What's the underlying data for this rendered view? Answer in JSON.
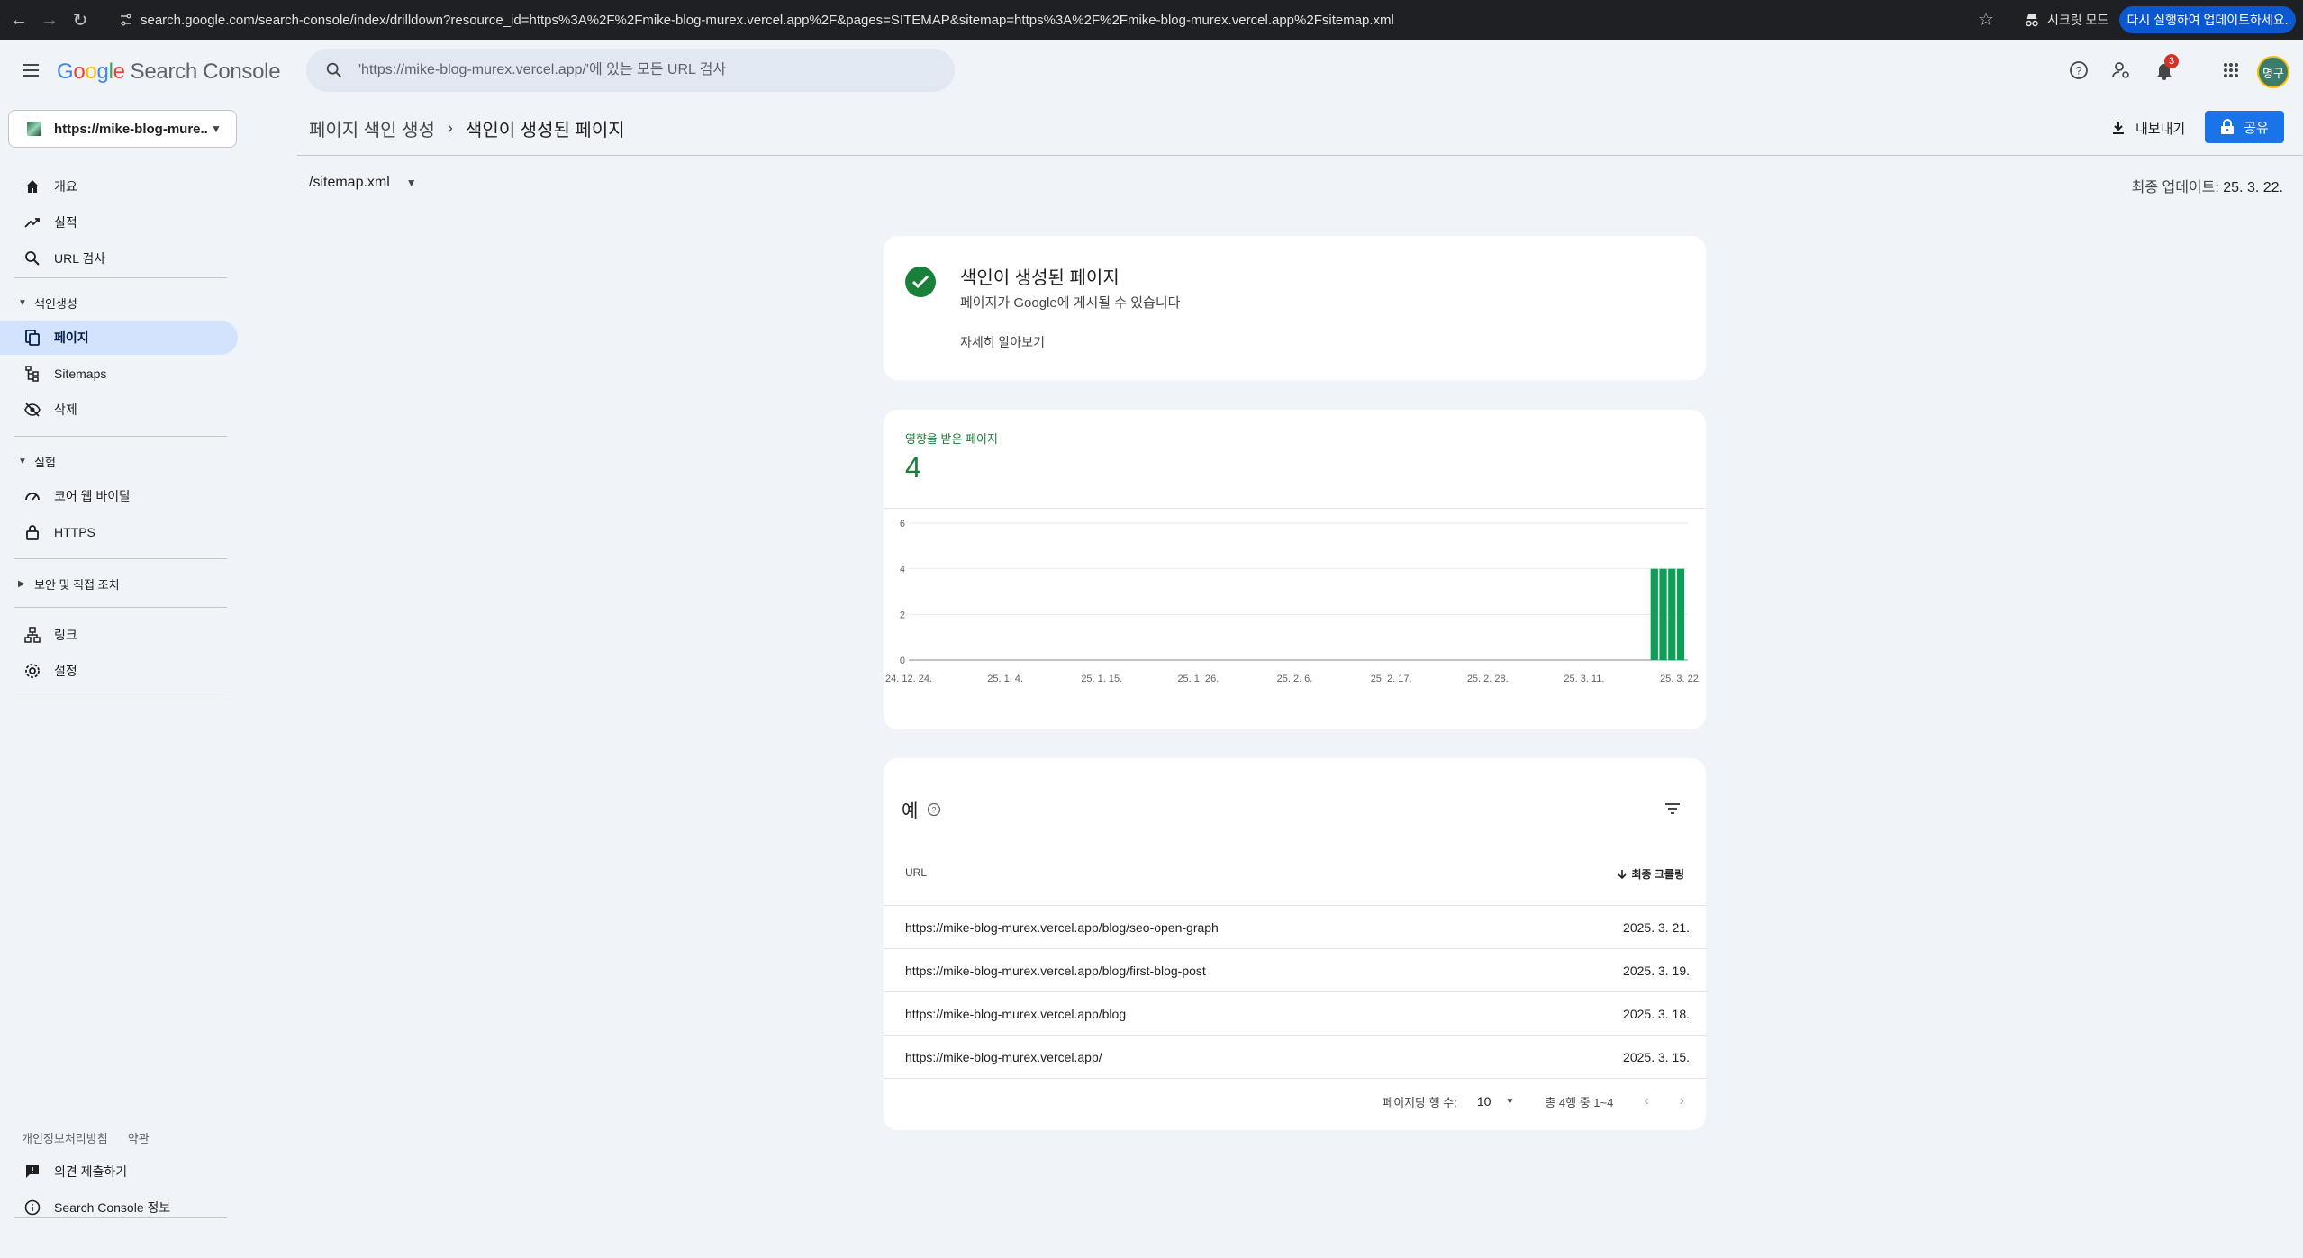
{
  "browser": {
    "url": "search.google.com/search-console/index/drilldown?resource_id=https%3A%2F%2Fmike-blog-murex.vercel.app%2F&pages=SITEMAP&sitemap=https%3A%2F%2Fmike-blog-murex.vercel.app%2Fsitemap.xml",
    "incognito_label": "시크릿 모드",
    "update_label": "다시 실행하여 업데이트하세요."
  },
  "header": {
    "logo_google": [
      "G",
      "o",
      "o",
      "g",
      "l",
      "e"
    ],
    "logo_product": "Search Console",
    "search_placeholder": "'https://mike-blog-murex.vercel.app/'에 있는 모든 URL 검사",
    "notification_count": "3",
    "avatar_text": "명구"
  },
  "sidebar": {
    "property": "https://mike-blog-mure...",
    "items_top": [
      {
        "label": "개요",
        "icon": "home-icon"
      },
      {
        "label": "실적",
        "icon": "trending-up-icon"
      },
      {
        "label": "URL 검사",
        "icon": "search-icon"
      }
    ],
    "section_indexing": "색인생성",
    "items_indexing": [
      {
        "label": "페이지",
        "icon": "pages-icon",
        "active": true
      },
      {
        "label": "Sitemaps",
        "icon": "sitemap-icon"
      },
      {
        "label": "삭제",
        "icon": "visibility-off-icon"
      }
    ],
    "section_experience": "실험",
    "items_experience": [
      {
        "label": "코어 웹 바이탈",
        "icon": "speed-icon"
      },
      {
        "label": "HTTPS",
        "icon": "lock-icon"
      }
    ],
    "section_security": "보안 및 직접 조치",
    "items_bottom": [
      {
        "label": "링크",
        "icon": "links-icon"
      },
      {
        "label": "설정",
        "icon": "gear-icon"
      }
    ],
    "feedback": "의견 제출하기",
    "about": "Search Console 정보",
    "privacy": "개인정보처리방침",
    "terms": "약관"
  },
  "main": {
    "breadcrumb_parent": "페이지 색인 생성",
    "breadcrumb_current": "색인이 생성된 페이지",
    "export_label": "내보내기",
    "share_label": "공유",
    "sitemap_value": "/sitemap.xml",
    "last_updated_label": "최종 업데이트:",
    "last_updated_value": "25. 3. 22.",
    "status_title": "색인이 생성된 페이지",
    "status_subtitle": "페이지가 Google에 게시될 수 있습니다",
    "status_link": "자세히 알아보기",
    "metric_label": "영향을 받은 페이지",
    "metric_value": "4",
    "table_title": "예",
    "col_url": "URL",
    "col_crawl": "최종 크롤링",
    "rows": [
      {
        "url": "https://mike-blog-murex.vercel.app/blog/seo-open-graph",
        "date": "2025. 3. 21."
      },
      {
        "url": "https://mike-blog-murex.vercel.app/blog/first-blog-post",
        "date": "2025. 3. 19."
      },
      {
        "url": "https://mike-blog-murex.vercel.app/blog",
        "date": "2025. 3. 18."
      },
      {
        "url": "https://mike-blog-murex.vercel.app/",
        "date": "2025. 3. 15."
      }
    ],
    "rows_per_page_label": "페이지당 행 수:",
    "rows_per_page_value": "10",
    "range_label": "총 4행 중 1~4"
  },
  "colors": {
    "accent": "#1a73e8",
    "success": "#188038",
    "bar": "#0f9d58",
    "active_nav": "#d3e3fd"
  },
  "chart_data": {
    "type": "bar",
    "title": "",
    "ylabel": "",
    "xlabel": "",
    "ylim": [
      0,
      6
    ],
    "yticks": [
      0,
      2,
      4,
      6
    ],
    "xticks": [
      "24. 12. 24.",
      "25. 1. 4.",
      "25. 1. 15.",
      "25. 1. 26.",
      "25. 2. 6.",
      "25. 2. 17.",
      "25. 2. 28.",
      "25. 3. 11.",
      "25. 3. 22."
    ],
    "x": [
      "24. 12. 24.",
      "24. 12. 25.",
      "24. 12. 26.",
      "24. 12. 27.",
      "24. 12. 28.",
      "24. 12. 29.",
      "24. 12. 30.",
      "24. 12. 31.",
      "25. 1. 1.",
      "25. 1. 2.",
      "25. 1. 3.",
      "25. 1. 4.",
      "25. 1. 5.",
      "25. 1. 6.",
      "25. 1. 7.",
      "25. 1. 8.",
      "25. 1. 9.",
      "25. 1. 10.",
      "25. 1. 11.",
      "25. 1. 12.",
      "25. 1. 13.",
      "25. 1. 14.",
      "25. 1. 15.",
      "25. 1. 16.",
      "25. 1. 17.",
      "25. 1. 18.",
      "25. 1. 19.",
      "25. 1. 20.",
      "25. 1. 21.",
      "25. 1. 22.",
      "25. 1. 23.",
      "25. 1. 24.",
      "25. 1. 25.",
      "25. 1. 26.",
      "25. 1. 27.",
      "25. 1. 28.",
      "25. 1. 29.",
      "25. 1. 30.",
      "25. 1. 31.",
      "25. 2. 1.",
      "25. 2. 2.",
      "25. 2. 3.",
      "25. 2. 4.",
      "25. 2. 5.",
      "25. 2. 6.",
      "25. 2. 7.",
      "25. 2. 8.",
      "25. 2. 9.",
      "25. 2. 10.",
      "25. 2. 11.",
      "25. 2. 12.",
      "25. 2. 13.",
      "25. 2. 14.",
      "25. 2. 15.",
      "25. 2. 16.",
      "25. 2. 17.",
      "25. 2. 18.",
      "25. 2. 19.",
      "25. 2. 20.",
      "25. 2. 21.",
      "25. 2. 22.",
      "25. 2. 23.",
      "25. 2. 24.",
      "25. 2. 25.",
      "25. 2. 26.",
      "25. 2. 27.",
      "25. 2. 28.",
      "25. 3. 1.",
      "25. 3. 2.",
      "25. 3. 3.",
      "25. 3. 4.",
      "25. 3. 5.",
      "25. 3. 6.",
      "25. 3. 7.",
      "25. 3. 8.",
      "25. 3. 9.",
      "25. 3. 10.",
      "25. 3. 11.",
      "25. 3. 12.",
      "25. 3. 13.",
      "25. 3. 14.",
      "25. 3. 15.",
      "25. 3. 16.",
      "25. 3. 17.",
      "25. 3. 18.",
      "25. 3. 19.",
      "25. 3. 20.",
      "25. 3. 21.",
      "25. 3. 22."
    ],
    "values": [
      0,
      0,
      0,
      0,
      0,
      0,
      0,
      0,
      0,
      0,
      0,
      0,
      0,
      0,
      0,
      0,
      0,
      0,
      0,
      0,
      0,
      0,
      0,
      0,
      0,
      0,
      0,
      0,
      0,
      0,
      0,
      0,
      0,
      0,
      0,
      0,
      0,
      0,
      0,
      0,
      0,
      0,
      0,
      0,
      0,
      0,
      0,
      0,
      0,
      0,
      0,
      0,
      0,
      0,
      0,
      0,
      0,
      0,
      0,
      0,
      0,
      0,
      0,
      0,
      0,
      0,
      0,
      0,
      0,
      0,
      0,
      0,
      0,
      0,
      0,
      0,
      0,
      0,
      0,
      0,
      0,
      0,
      0,
      0,
      0,
      4,
      4,
      4,
      4
    ],
    "grid": true
  }
}
